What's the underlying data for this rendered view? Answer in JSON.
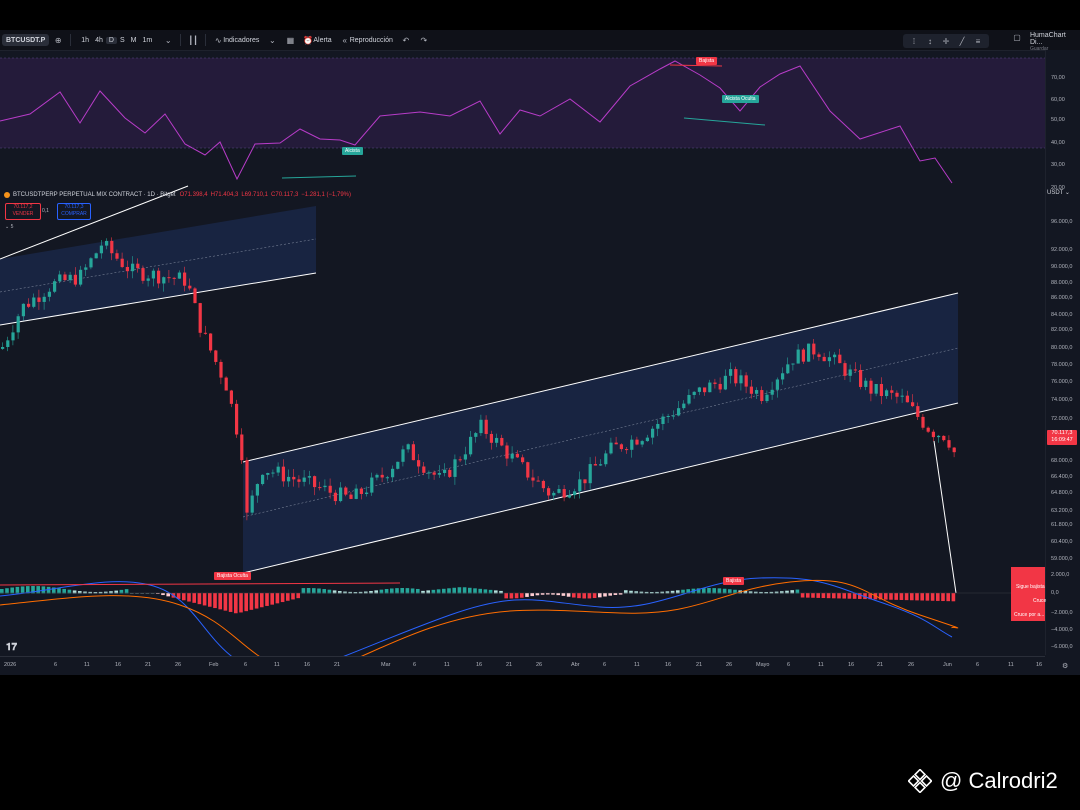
{
  "toolbar": {
    "symbol": "BTCUSDT.P",
    "timeframes": [
      "1h",
      "4h",
      "D",
      "S",
      "M",
      "1m"
    ],
    "active_timeframe": "D",
    "indicators_label": "Indicadores",
    "alert_label": "Alerta",
    "replay_label": "Reproducción",
    "account_name": "HumaChart Di...",
    "account_sub": "Guardar"
  },
  "legend": {
    "title": "BTCUSDTPERP PERPETUAL MIX CONTRACT · 1D · Bitget",
    "open": "O71.398,4",
    "high": "H71.404,3",
    "low": "L69.710,1",
    "close": "C70.117,3",
    "change": "−1.281,1 (−1,79%)"
  },
  "order": {
    "sell_price": "70.117,2",
    "sell_label": "VENDER",
    "spread": "0,1",
    "buy_price": "70.117,3",
    "buy_label": "COMPRAR",
    "qty": "5"
  },
  "last_price": {
    "price": "70.117,3",
    "countdown": "16:09:47"
  },
  "currency": "USDT",
  "price_axis": [
    "96.000,0",
    "92.000,0",
    "90.000,0",
    "88.000,0",
    "86.000,0",
    "84.000,0",
    "82.000,0",
    "80.000,0",
    "78.000,0",
    "76.000,0",
    "74.000,0",
    "72.000,0",
    "68.000,0",
    "66.400,0",
    "64.800,0",
    "63.200,0",
    "61.800,0",
    "60.400,0",
    "59.000,0"
  ],
  "rsi_axis": [
    "70,00",
    "60,00",
    "50,00",
    "40,00",
    "30,00",
    "20,00"
  ],
  "macd_axis": [
    "2.000,0",
    "0,0",
    "−2.000,0",
    "−4.000,0",
    "−6.000,0"
  ],
  "time_axis": [
    "2026",
    "6",
    "11",
    "16",
    "21",
    "26",
    "Feb",
    "6",
    "11",
    "16",
    "21",
    "Mar",
    "6",
    "11",
    "16",
    "21",
    "26",
    "Abr",
    "6",
    "11",
    "16",
    "21",
    "26",
    "Mayo",
    "6",
    "11",
    "16",
    "21",
    "26",
    "Jun",
    "6",
    "11",
    "16"
  ],
  "annotations": {
    "rsi_bearish": "Bajista",
    "rsi_hidden_bullish": "Alcista Oculta",
    "rsi_bullish": "Alcista",
    "macd_hidden_bearish": "Bajista Oculta",
    "macd_bearish": "Bajista"
  },
  "macd_panel": {
    "line1": "Sigue bajista",
    "line2": "Cruce",
    "line3": "Cruce por a..."
  },
  "watermark": "@ Calrodri2",
  "colors": {
    "up": "#26a69a",
    "down": "#f23645",
    "rsi_line": "#b83cc9",
    "macd_line": "#2962ff",
    "signal_line": "#ff6d00",
    "channel_fill": "#1a2747"
  },
  "chart_data": {
    "type": "candlestick",
    "title": "BTCUSDTPERP PERPETUAL MIX CONTRACT · 1D · Bitget",
    "y_range": [
      58000,
      98000
    ],
    "current": {
      "open": 71398.4,
      "high": 71404.3,
      "low": 69710.1,
      "close": 70117.3
    }
  }
}
